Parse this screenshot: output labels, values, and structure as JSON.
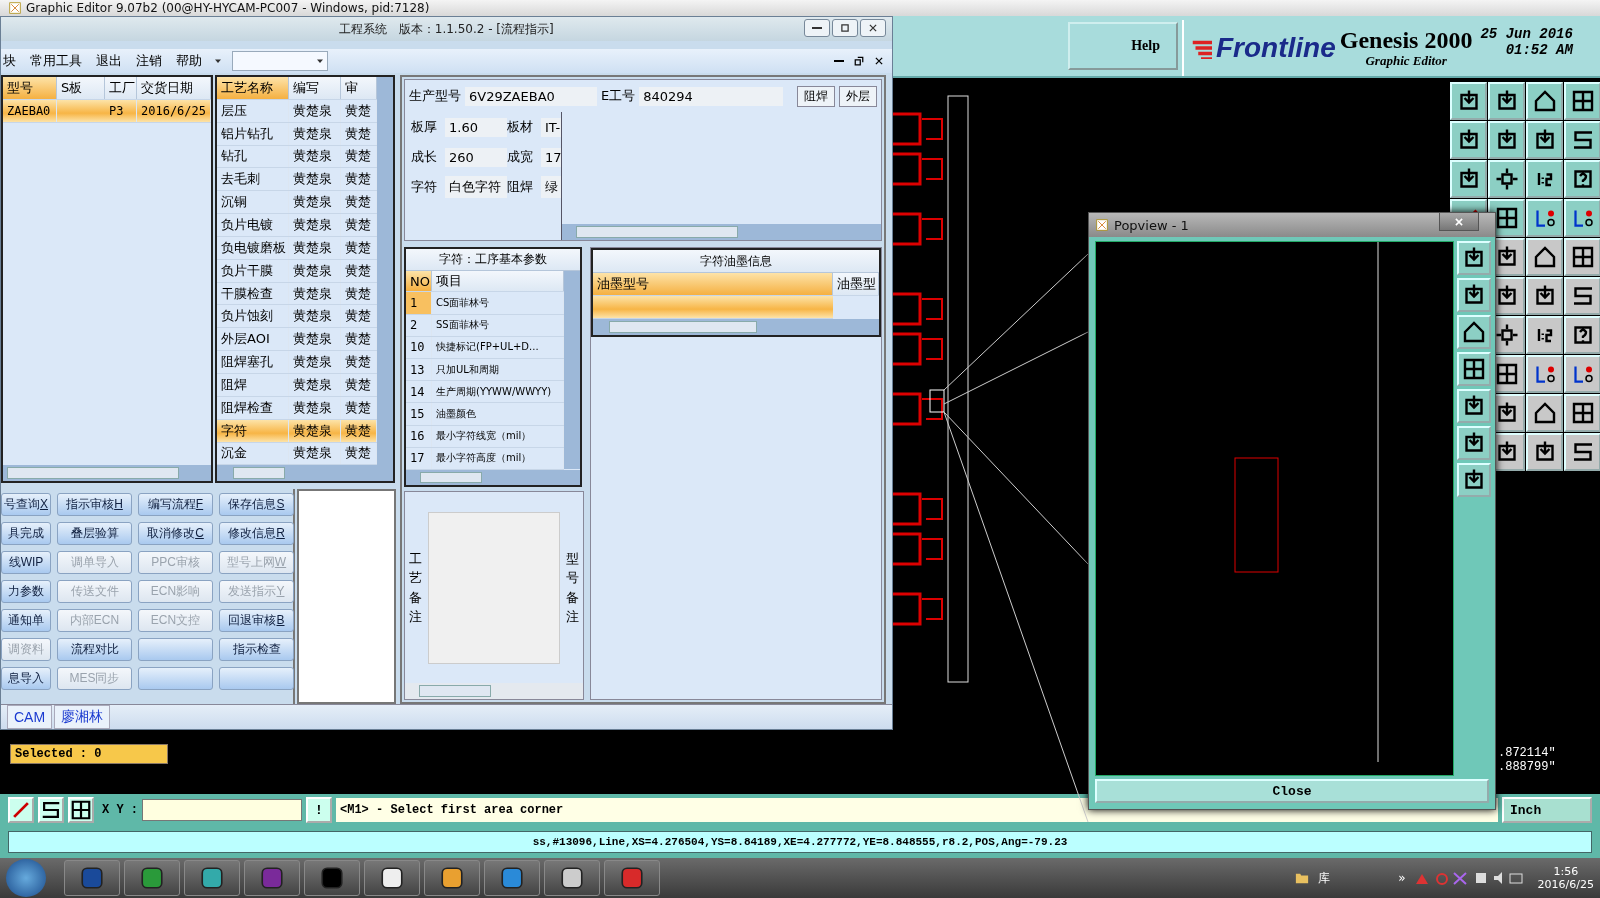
{
  "genesis": {
    "title": "Graphic Editor 9.07b2 (00@HY-HYCAM-PC007 - Windows, pid:7128)",
    "help": "Help",
    "logo": "Frontline",
    "product": "Genesis 2000",
    "subtitle": "Graphic Editor",
    "date": "25 Jun 2016",
    "time": "01:52 AM",
    "selected": "Selected : 0",
    "xy_label": "X Y :",
    "alert": "!",
    "prompt": "<M1> - Select first area corner",
    "coords": [
      ".872114\"",
      ".888799\""
    ],
    "units": "Inch",
    "status": "ss,#13096,Line,XS=4.276504,YS=8.84189,XE=4.277772,YE=8.848555,r8.2,POS,Ang=-79.23"
  },
  "engineering": {
    "title": "工程系统   版本：1.1.50.2 - [流程指示]",
    "menu": [
      "块",
      "常用工具",
      "退出",
      "注销",
      "帮助"
    ],
    "orders": {
      "columns": [
        "型号",
        "S板",
        "工厂",
        "交货日期"
      ],
      "rows": [
        {
          "model": "ZAEBA0",
          "factory": "P3",
          "due": "2016/6/25",
          "selected": true
        }
      ]
    },
    "processes": {
      "columns": [
        "工艺名称",
        "编写",
        "审"
      ],
      "rows": [
        {
          "name": "层压",
          "writer": "黄楚泉",
          "reviewer": "黄楚",
          "selected": false
        },
        {
          "name": "铝片钻孔",
          "writer": "黄楚泉",
          "reviewer": "黄楚",
          "selected": false
        },
        {
          "name": "钻孔",
          "writer": "黄楚泉",
          "reviewer": "黄楚",
          "selected": false
        },
        {
          "name": "去毛刺",
          "writer": "黄楚泉",
          "reviewer": "黄楚",
          "selected": false
        },
        {
          "name": "沉铜",
          "writer": "黄楚泉",
          "reviewer": "黄楚",
          "selected": false
        },
        {
          "name": "负片电镀",
          "writer": "黄楚泉",
          "reviewer": "黄楚",
          "selected": false
        },
        {
          "name": "负电镀磨板",
          "writer": "黄楚泉",
          "reviewer": "黄楚",
          "selected": false
        },
        {
          "name": "负片干膜",
          "writer": "黄楚泉",
          "reviewer": "黄楚",
          "selected": false
        },
        {
          "name": "干膜检查",
          "writer": "黄楚泉",
          "reviewer": "黄楚",
          "selected": false
        },
        {
          "name": "负片蚀刻",
          "writer": "黄楚泉",
          "reviewer": "黄楚",
          "selected": false
        },
        {
          "name": "外层AOI",
          "writer": "黄楚泉",
          "reviewer": "黄楚",
          "selected": false
        },
        {
          "name": "阻焊塞孔",
          "writer": "黄楚泉",
          "reviewer": "黄楚",
          "selected": false
        },
        {
          "name": "阻焊",
          "writer": "黄楚泉",
          "reviewer": "黄楚",
          "selected": false
        },
        {
          "name": "阻焊检查",
          "writer": "黄楚泉",
          "reviewer": "黄楚",
          "selected": false
        },
        {
          "name": "字符",
          "writer": "黄楚泉",
          "reviewer": "黄楚",
          "selected": true
        },
        {
          "name": "沉金",
          "writer": "黄楚泉",
          "reviewer": "黄楚",
          "selected": false
        }
      ]
    },
    "buttons": [
      {
        "label": "号查询",
        "hotkey": "X",
        "disabled": false
      },
      {
        "label": "指示审核",
        "hotkey": "H",
        "disabled": false
      },
      {
        "label": "编写流程",
        "hotkey": "F",
        "disabled": false
      },
      {
        "label": "保存信息",
        "hotkey": "S",
        "disabled": false
      },
      {
        "label": "具完成",
        "disabled": false
      },
      {
        "label": "叠层验算",
        "disabled": false
      },
      {
        "label": "取消修改",
        "hotkey": "C",
        "disabled": false
      },
      {
        "label": "修改信息",
        "hotkey": "R",
        "disabled": false
      },
      {
        "label": "线WIP",
        "disabled": false
      },
      {
        "label": "调单导入",
        "disabled": true
      },
      {
        "label": "PPC审核",
        "disabled": true
      },
      {
        "label": "型号上网",
        "hotkey": "W",
        "disabled": true
      },
      {
        "label": "力参数",
        "disabled": false
      },
      {
        "label": "传送文件",
        "disabled": true
      },
      {
        "label": "ECN影响",
        "disabled": true
      },
      {
        "label": "发送指示",
        "hotkey": "Y",
        "disabled": true
      },
      {
        "label": "通知单",
        "disabled": false
      },
      {
        "label": "内部ECN",
        "disabled": true
      },
      {
        "label": "ECN文控",
        "disabled": true
      },
      {
        "label": "回退审核",
        "hotkey": "B",
        "disabled": false
      },
      {
        "label": "调资料",
        "disabled": true
      },
      {
        "label": "流程对比",
        "disabled": false
      },
      {
        "disabled": false
      },
      {
        "label": "指示检查",
        "disabled": false
      },
      {
        "label": "息导入",
        "disabled": false
      },
      {
        "label": "MES同步",
        "disabled": true
      },
      {
        "disabled": false
      },
      {
        "disabled": false
      }
    ],
    "tabs": [
      {
        "label": "CAM"
      },
      {
        "label": "廖湘林"
      }
    ],
    "info": {
      "top": [
        {
          "label": "生产型号",
          "value": "6V29ZAEBA0"
        },
        {
          "label": "E工号",
          "value": "840294"
        }
      ],
      "layer_tabs": [
        "阻焊",
        "外层"
      ],
      "grid": [
        [
          {
            "label": "板厚",
            "value": "1.60"
          },
          {
            "label": "板材",
            "value": "IT-"
          }
        ],
        [
          {
            "label": "成长",
            "value": "260"
          },
          {
            "label": "成宽",
            "value": "17"
          }
        ],
        [
          {
            "label": "字符",
            "value": "白色字符"
          },
          {
            "label": "阻焊",
            "value": "绿"
          }
        ]
      ]
    },
    "params": {
      "title": "字符：工序基本参数",
      "columns": [
        "NO",
        "项目"
      ],
      "rows": [
        {
          "no": "1",
          "item": "CS面菲林号",
          "selected": true
        },
        {
          "no": "2",
          "item": "SS面菲林号",
          "selected": false
        },
        {
          "no": "10",
          "item": "快捷标记(FP+UL+D...",
          "selected": false
        },
        {
          "no": "13",
          "item": "只加UL和周期",
          "selected": false
        },
        {
          "no": "14",
          "item": "生产周期(YYWW/WWYY)",
          "selected": false
        },
        {
          "no": "15",
          "item": "油墨颜色",
          "selected": false
        },
        {
          "no": "16",
          "item": "最小字符线宽（mil）",
          "selected": false
        },
        {
          "no": "17",
          "item": "最小字符高度（mil）",
          "selected": false
        }
      ]
    },
    "ink": {
      "title": "字符油墨信息",
      "columns": [
        "油墨型号",
        "油墨型"
      ],
      "rows": [
        {
          "selected": true
        }
      ]
    },
    "notes": [
      "工艺备注",
      "型号备注"
    ]
  },
  "popview": {
    "title": "Popview - 1",
    "close": "Close"
  },
  "taskbar": {
    "tray_label": "库",
    "overflow": "»",
    "time": "1:56",
    "date": "2016/6/25"
  }
}
